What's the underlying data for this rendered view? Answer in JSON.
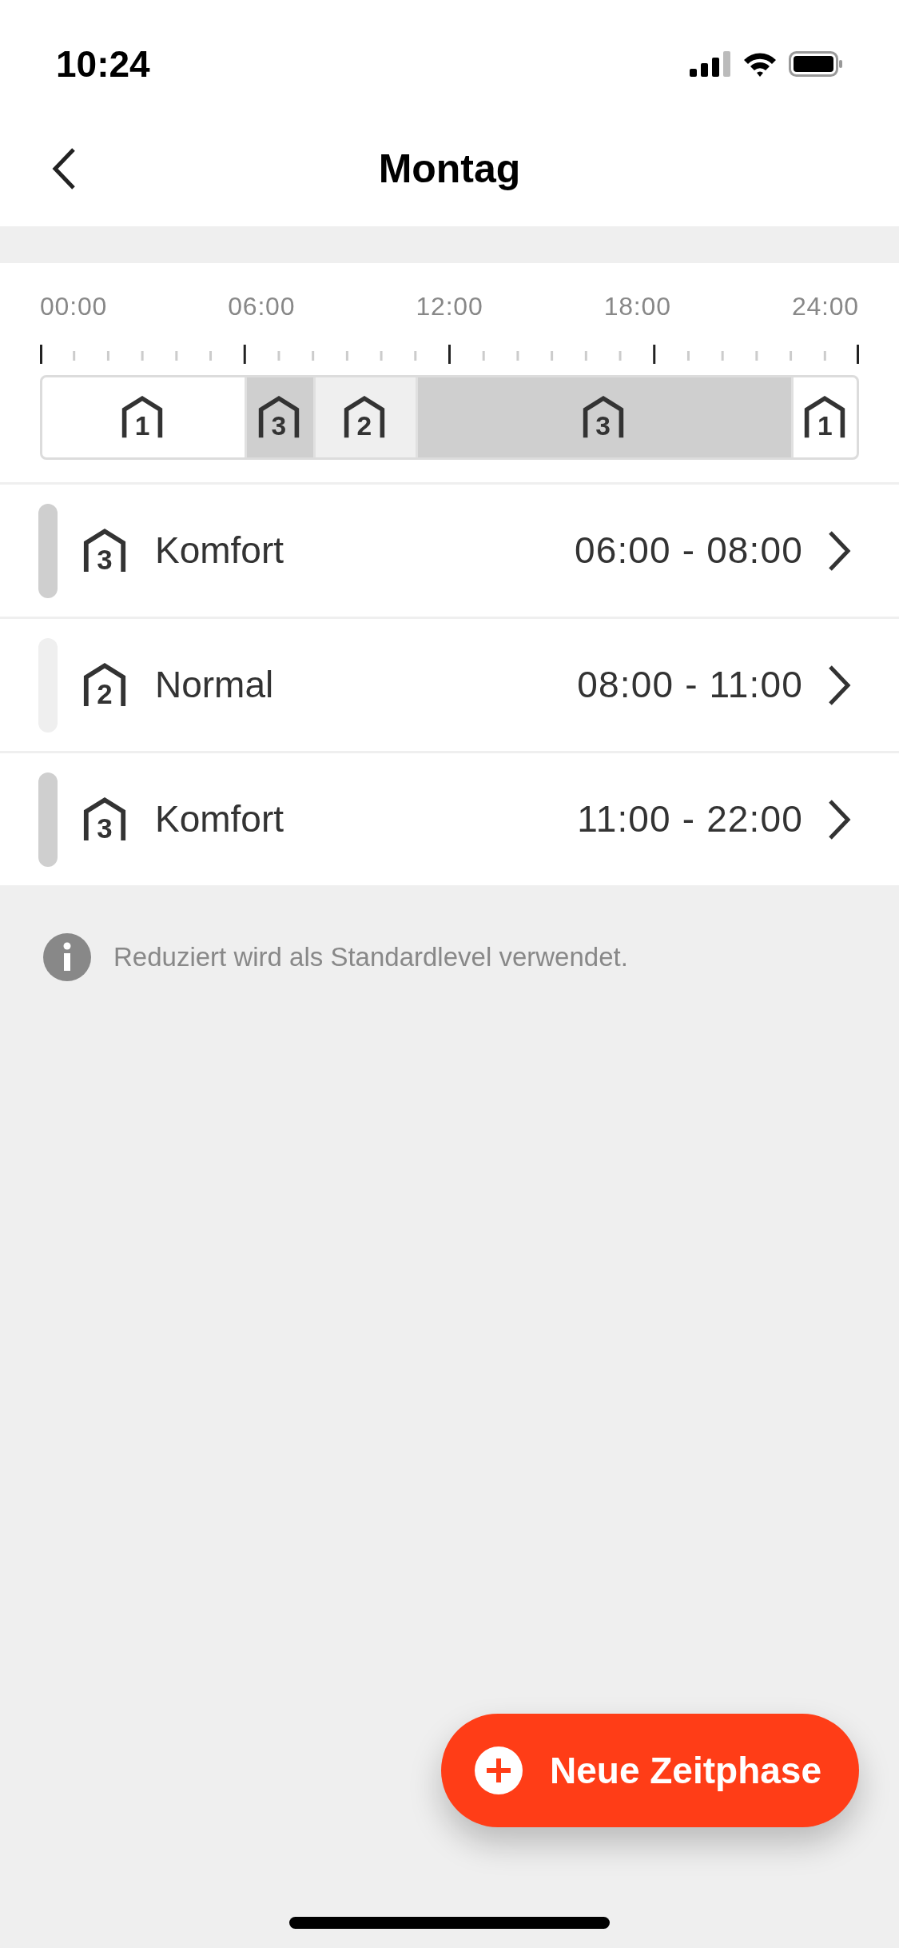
{
  "status_bar": {
    "time": "10:24"
  },
  "nav": {
    "title": "Montag"
  },
  "timeline": {
    "labels": [
      "00:00",
      "06:00",
      "12:00",
      "18:00",
      "24:00"
    ],
    "segments": [
      {
        "number": "1",
        "color": "#ffffff"
      },
      {
        "number": "3",
        "color": "#cfcfcf"
      },
      {
        "number": "2",
        "color": "#efefef"
      },
      {
        "number": "3",
        "color": "#cfcfcf"
      },
      {
        "number": "1",
        "color": "#ffffff"
      }
    ]
  },
  "periods": [
    {
      "number": "3",
      "name": "Komfort",
      "time": "06:00 - 08:00",
      "color": "#cfcfcf"
    },
    {
      "number": "2",
      "name": "Normal",
      "time": "08:00 - 11:00",
      "color": "#efefef"
    },
    {
      "number": "3",
      "name": "Komfort",
      "time": "11:00 - 22:00",
      "color": "#cfcfcf"
    }
  ],
  "info": "Reduziert wird als Standardlevel verwendet.",
  "action": {
    "label": "Neue Zeitphase"
  }
}
